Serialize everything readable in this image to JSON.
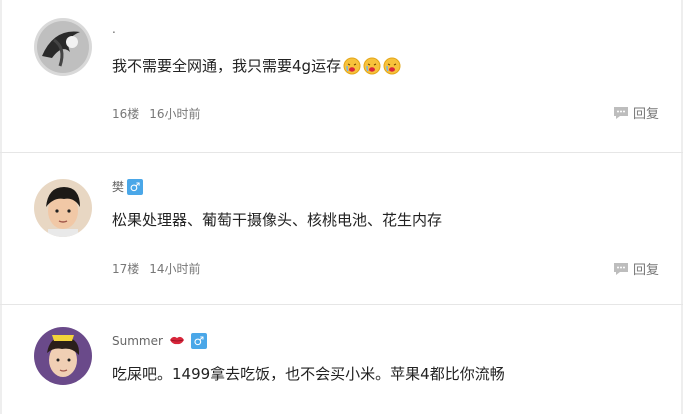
{
  "comments": [
    {
      "username": ".",
      "text": "我不需要全网通，我只需要4g运存",
      "floor": "16楼",
      "time": "16小时前",
      "reply_label": "回复",
      "emojis": [
        "crying-face-emoji",
        "crying-face-emoji",
        "crying-face-emoji"
      ]
    },
    {
      "username": "樊",
      "gender_icon": "♂",
      "text": "松果处理器、葡萄干摄像头、核桃电池、花生内存",
      "floor": "17楼",
      "time": "14小时前",
      "reply_label": "回复"
    },
    {
      "username": "Summer",
      "gender_icon": "♂",
      "badge_icon": "lips-icon",
      "text": "吃屎吧。1499拿去吃饭，也不会买小米。苹果4都比你流畅"
    }
  ]
}
